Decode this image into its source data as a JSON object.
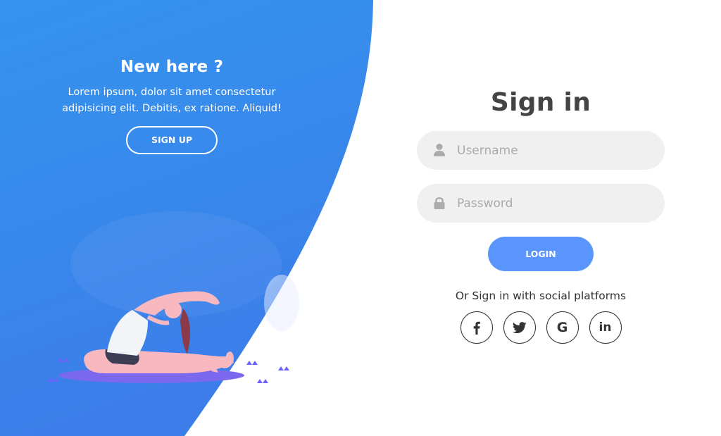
{
  "panel": {
    "title": "New here ?",
    "text": "Lorem ipsum, dolor sit amet consectetur adipisicing elit. Debitis, ex ratione. Aliquid!",
    "signup_label": "SIGN UP"
  },
  "form": {
    "title": "Sign in",
    "username_placeholder": "Username",
    "password_placeholder": "Password",
    "login_label": "LOGIN",
    "social_text": "Or Sign in with social platforms",
    "social": [
      {
        "icon": "facebook-icon"
      },
      {
        "icon": "twitter-icon"
      },
      {
        "icon": "google-icon",
        "glyph": "G"
      },
      {
        "icon": "linkedin-icon",
        "glyph": "in"
      }
    ]
  },
  "colors": {
    "panel_blue_top": "#3494ee",
    "panel_blue_bottom": "#3c7de9",
    "accent": "#5995fd",
    "input_bg": "#f0f0f0",
    "title": "#444444"
  },
  "icons": [
    "user-icon",
    "lock-icon",
    "facebook-icon",
    "twitter-icon",
    "google-icon",
    "linkedin-icon",
    "yoga-illustration"
  ]
}
